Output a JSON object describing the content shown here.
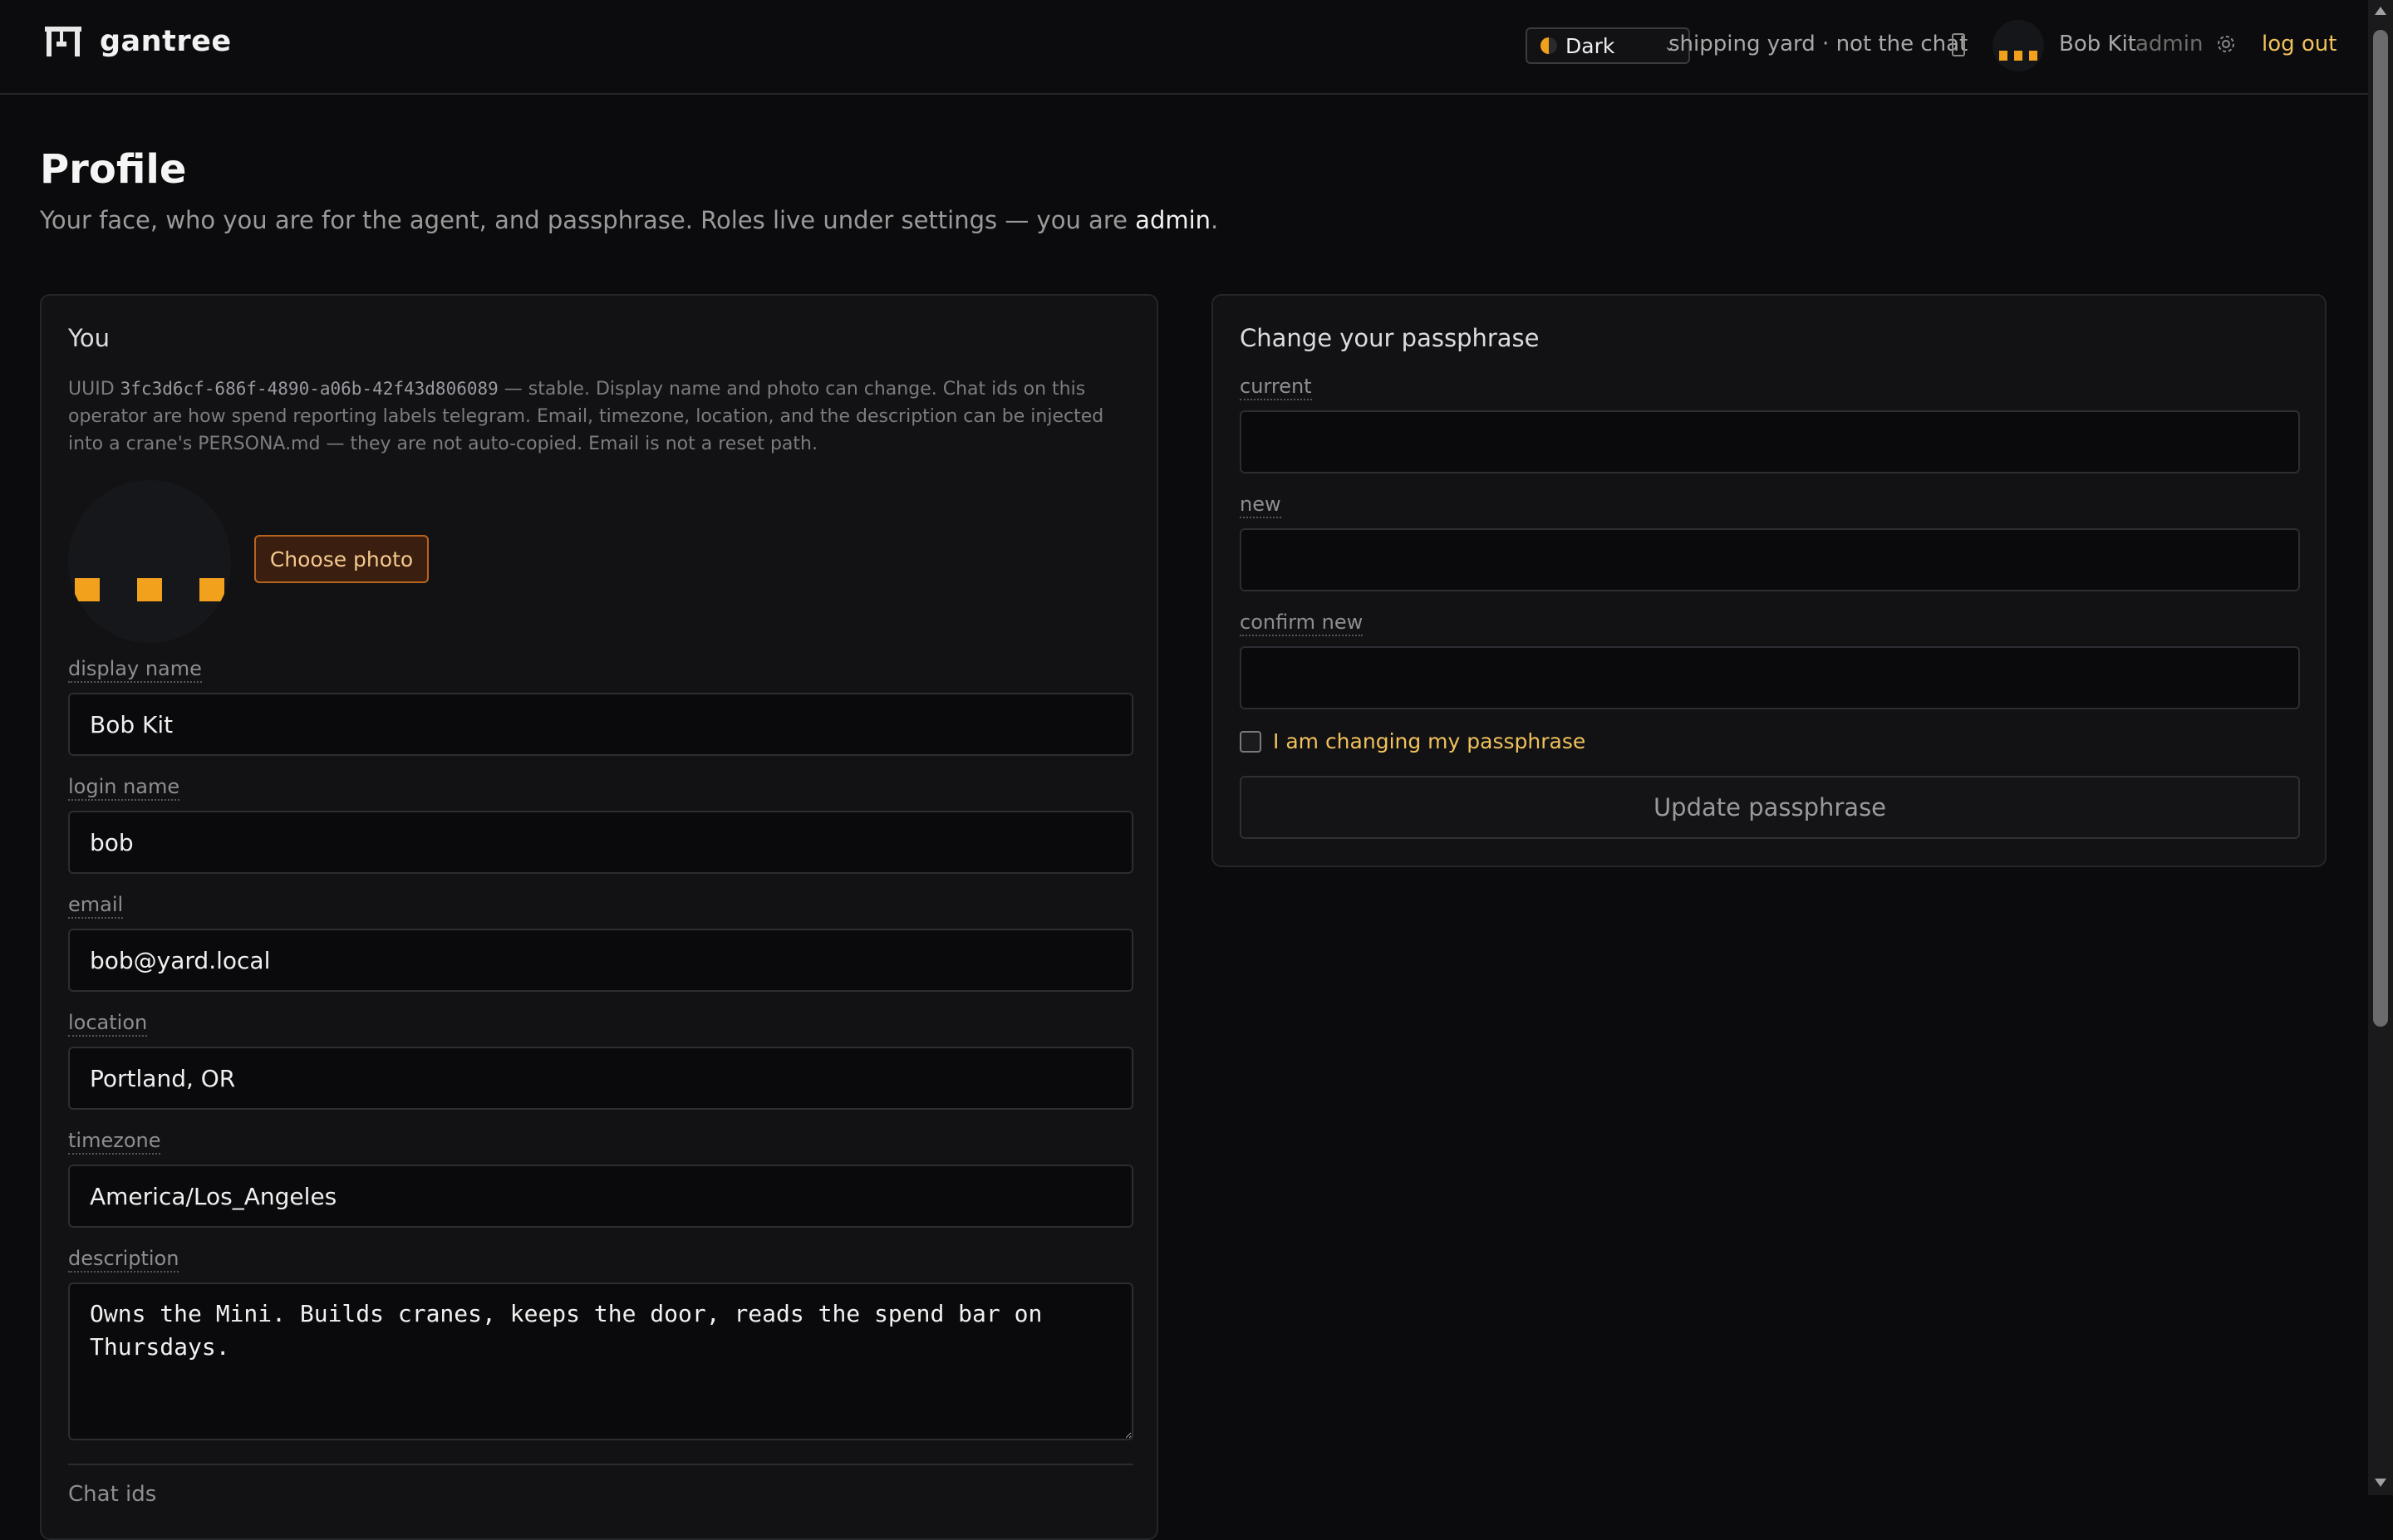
{
  "header": {
    "app_name": "gantree",
    "theme_value": "Dark",
    "workspace": "shipping yard · not the chat",
    "user_name": "Bob Kit",
    "user_role": "admin",
    "logout_label": "log out",
    "icons": [
      "gantry-logo-icon",
      "theme-half-circle-icon",
      "chevron-down-icon",
      "phone-icon",
      "avatar",
      "gear-icon"
    ]
  },
  "page": {
    "title": "Profile",
    "subtitle_prefix": "Your face, who you are for the agent, and passphrase. Roles live under settings — you are ",
    "subtitle_role": "admin",
    "subtitle_suffix": "."
  },
  "you": {
    "title": "You",
    "uuid_label": "UUID",
    "uuid": "3fc3d6cf-686f-4890-a06b-42f43d806089",
    "note": " — stable. Display name and photo can change. Chat ids on this operator are how spend reporting labels telegram. Email, timezone, location, and the description can be injected into a crane's PERSONA.md — they are not auto-copied. Email is not a reset path.",
    "choose_photo": "Choose photo",
    "fields": {
      "display_name": {
        "label": "display name",
        "value": "Bob Kit"
      },
      "login_name": {
        "label": "login name",
        "value": "bob"
      },
      "email": {
        "label": "email",
        "value": "bob@yard.local"
      },
      "location": {
        "label": "location",
        "value": "Portland, OR"
      },
      "timezone": {
        "label": "timezone",
        "value": "America/Los_Angeles"
      },
      "description": {
        "label": "description",
        "value": "Owns the Mini. Builds cranes, keeps the door, reads the spend bar on Thursdays."
      }
    },
    "chat_ids_label": "Chat ids"
  },
  "passphrase": {
    "title": "Change your passphrase",
    "current_label": "current",
    "new_label": "new",
    "confirm_label": "confirm new",
    "current_value": "",
    "new_value": "",
    "confirm_value": "",
    "checkbox_label": "I am changing my passphrase",
    "checkbox_checked": false,
    "submit_label": "Update passphrase"
  },
  "colors": {
    "accent": "#f2a11c",
    "link": "#f0c15c",
    "background": "#0b0b0d",
    "card": "#121215"
  }
}
